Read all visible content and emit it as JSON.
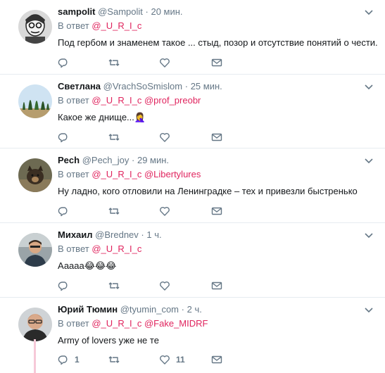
{
  "tweets": [
    {
      "name": "sampolit",
      "handle": "@Sampolit",
      "time": "20 мин.",
      "reply_prefix": "В ответ",
      "reply_to": "@_U_R_I_c",
      "reply_to_2": "",
      "text": "Под гербом и знаменем такое ... стыд, позор и отсутствие понятий о чести.",
      "reply_count": "",
      "retweet_count": "",
      "like_count": ""
    },
    {
      "name": "Светлана",
      "handle": "@VrachSoSmislom",
      "time": "25 мин.",
      "reply_prefix": "В ответ",
      "reply_to": "@_U_R_I_c",
      "reply_to_2": "@prof_preobr",
      "text": "Какое же днище...",
      "emoji": "🤦‍♀️",
      "reply_count": "",
      "retweet_count": "",
      "like_count": ""
    },
    {
      "name": "Pech",
      "handle": "@Pech_joy",
      "time": "29 мин.",
      "reply_prefix": "В ответ",
      "reply_to": "@_U_R_I_c",
      "reply_to_2": "@Libertylures",
      "text": "Ну ладно, кого отловили на Ленинградке – тех и  привезли быстренько",
      "reply_count": "",
      "retweet_count": "",
      "like_count": ""
    },
    {
      "name": "Михаил",
      "handle": "@Brednev",
      "time": "1 ч.",
      "reply_prefix": "В ответ",
      "reply_to": "@_U_R_I_c",
      "reply_to_2": "",
      "text": "Ааааа",
      "emoji": "😂😂😂",
      "reply_count": "",
      "retweet_count": "",
      "like_count": ""
    },
    {
      "name": "Юрий Тюмин",
      "handle": "@tyumin_com",
      "time": "2 ч.",
      "reply_prefix": "В ответ",
      "reply_to": "@_U_R_I_c",
      "reply_to_2": "@Fake_MIDRF",
      "text": "Army of lovers уже не те",
      "reply_count": "1",
      "retweet_count": "",
      "like_count": "11"
    }
  ],
  "colors": {
    "link": "#e0245e",
    "muted": "#657786",
    "text": "#14171a",
    "divider": "#e6ecf0"
  },
  "icons": {
    "menu": "chevron-down-icon",
    "reply": "reply-icon",
    "retweet": "retweet-icon",
    "like": "heart-icon",
    "dm": "envelope-icon"
  }
}
